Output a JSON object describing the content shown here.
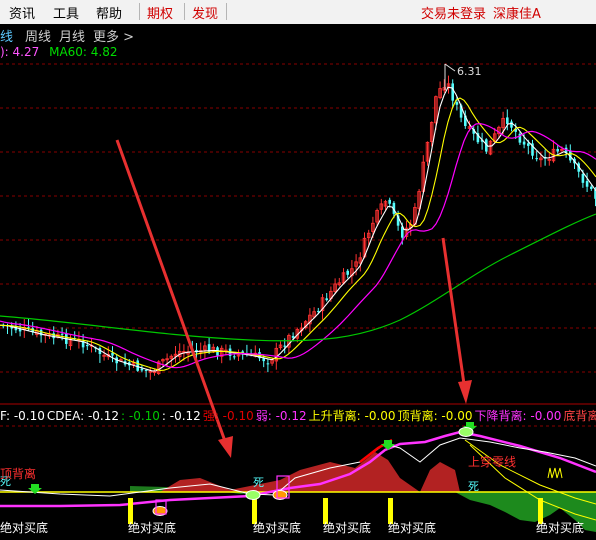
{
  "menu": {
    "items": [
      "资讯",
      "工具",
      "帮助"
    ],
    "red_items": [
      "期权",
      "发现"
    ],
    "account_status": "交易未登录",
    "stock_name": "深康佳A"
  },
  "period_tabs": [
    "线",
    "周线",
    "月线",
    "更多 >"
  ],
  "ma_labels": {
    "ma_a": "): 4.27",
    "ma60": "MA60: 4.82"
  },
  "chart": {
    "peak_label": "6.31"
  },
  "indicator_row": [
    {
      "text": "F: -0.10",
      "color": "#ffffff"
    },
    {
      "text": "CDEA: -0.12",
      "color": "#ffffff"
    },
    {
      "text": ": -0.10",
      "color": "#00c800"
    },
    {
      "text": ": -0.12",
      "color": "#ffffff"
    },
    {
      "text": "强: -0.10",
      "color": "#e00000"
    },
    {
      "text": "弱: -0.12",
      "color": "#ff33ff"
    },
    {
      "text": "上升背离: -0.00",
      "color": "#ffff00"
    },
    {
      "text": "顶背离: -0.00",
      "color": "#ffff00"
    },
    {
      "text": "下降背离: -0.00",
      "color": "#ff33ff"
    },
    {
      "text": "底背离: -",
      "color": "#ff4444"
    }
  ],
  "lower": {
    "divergence_label": "顶背离",
    "zero_cross_label": "上穿零线",
    "death_label": "死",
    "buy_label": "绝对买底"
  },
  "colors": {
    "up": "#ff3232",
    "down": "#54fcfc",
    "ma_white": "#ffffff",
    "ma_yellow": "#ffff00",
    "ma_magenta": "#ff00ff",
    "ma_green": "#00c800",
    "grid": "#880000"
  }
}
